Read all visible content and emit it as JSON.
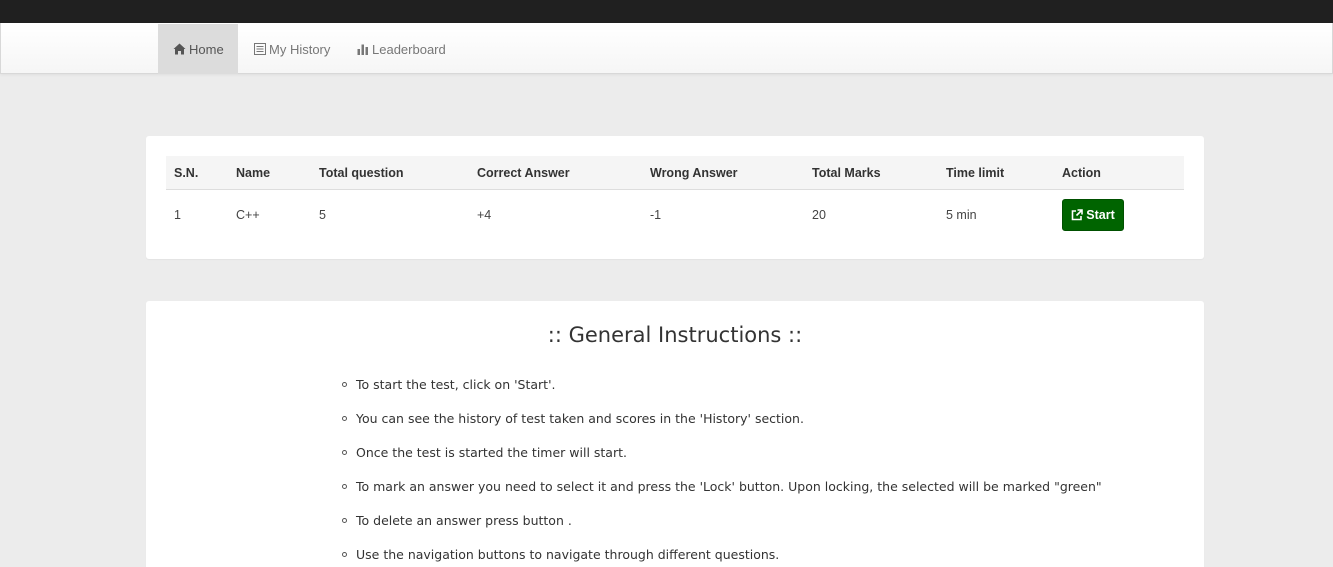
{
  "nav": {
    "items": [
      {
        "label": "Home",
        "icon": "home-icon",
        "active": true
      },
      {
        "label": "My History",
        "icon": "list-icon",
        "active": false
      },
      {
        "label": "Leaderboard",
        "icon": "bar-chart-icon",
        "active": false
      }
    ]
  },
  "quiz_table": {
    "headers": [
      "S.N.",
      "Name",
      "Total question",
      "Correct Answer",
      "Wrong Answer",
      "Total Marks",
      "Time limit",
      "Action"
    ],
    "rows": [
      {
        "sn": "1",
        "name": "C++",
        "total_question": "5",
        "correct_answer": "+4",
        "wrong_answer": "-1",
        "total_marks": "20",
        "time_limit": "5 min",
        "action_label": "Start"
      }
    ]
  },
  "instructions": {
    "title": ":: General Instructions ::",
    "items": [
      "To start the test, click on 'Start'.",
      "You can see the history of test taken and scores in the 'History' section.",
      "Once the test is started the timer will start.",
      "To mark an answer you need to select it and press the 'Lock' button. Upon locking, the selected will be marked \"green\"",
      "To delete an answer press button .",
      "Use the navigation buttons to navigate through different questions."
    ]
  },
  "colors": {
    "start_button": "#006400",
    "top_bar": "#202020",
    "background": "#ececec"
  }
}
